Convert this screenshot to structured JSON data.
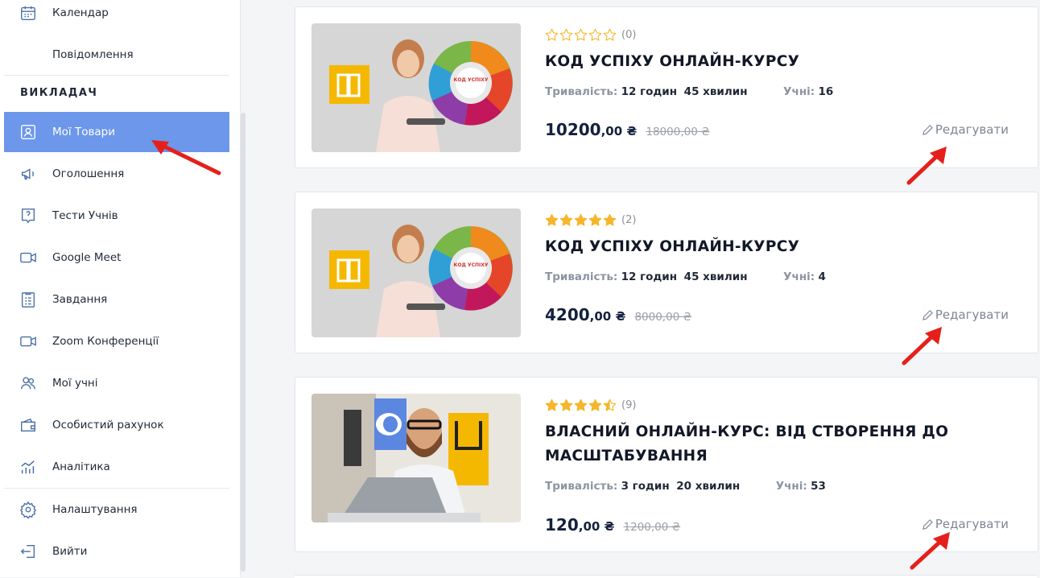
{
  "sidebar": {
    "items_top": [
      {
        "label": "Календар",
        "icon": "calendar-icon"
      },
      {
        "label": "Повідомлення",
        "icon": ""
      }
    ],
    "section_title": "ВИКЛАДАЧ",
    "items": [
      {
        "label": "Мої Товари",
        "icon": "user-card-icon",
        "active": true
      },
      {
        "label": "Оголошення",
        "icon": "megaphone-icon"
      },
      {
        "label": "Тести Учнів",
        "icon": "quiz-icon"
      },
      {
        "label": "Google Meet",
        "icon": "video-camera-icon"
      },
      {
        "label": "Завдання",
        "icon": "clipboard-icon"
      },
      {
        "label": "Zoom Конференції",
        "icon": "video-camera-icon"
      },
      {
        "label": "Мої учні",
        "icon": "users-icon"
      },
      {
        "label": "Особистий рахунок",
        "icon": "wallet-icon"
      },
      {
        "label": "Аналітика",
        "icon": "chart-icon"
      }
    ],
    "items_bottom": [
      {
        "label": "Налаштування",
        "icon": "gear-icon"
      },
      {
        "label": "Вийти",
        "icon": "logout-icon"
      }
    ]
  },
  "courses": [
    {
      "rating": 0,
      "rating_count": "(0)",
      "title": "КОД УСПІХУ ОНЛАЙН-КУРСУ",
      "duration_label": "Тривалість:",
      "duration_hours": "12 годин",
      "duration_minutes": "45 хвилин",
      "students_label": "Учні:",
      "students": "16",
      "price_main": "10200",
      "price_dec": ",00 ₴",
      "price_old": "18000,00 ₴",
      "edit_label": "Редагувати"
    },
    {
      "rating": 5,
      "rating_count": "(2)",
      "title": "КОД УСПІХУ ОНЛАЙН-КУРСУ",
      "duration_label": "Тривалість:",
      "duration_hours": "12 годин",
      "duration_minutes": "45 хвилин",
      "students_label": "Учні:",
      "students": "4",
      "price_main": "4200",
      "price_dec": ",00 ₴",
      "price_old": "8000,00 ₴",
      "edit_label": "Редагувати"
    },
    {
      "rating": 4.5,
      "rating_count": "(9)",
      "title": "ВЛАСНИЙ ОНЛАЙН-КУРС: ВІД СТВОРЕННЯ ДО МАСШТАБУВАННЯ",
      "duration_label": "Тривалість:",
      "duration_hours": "3 годин",
      "duration_minutes": "20 хвилин",
      "students_label": "Учні:",
      "students": "53",
      "price_main": "120",
      "price_dec": ",00 ₴",
      "price_old": "1200,00 ₴",
      "edit_label": "Редагувати"
    }
  ],
  "colors": {
    "active_item": "#6c97ea",
    "star": "#f5b62a",
    "arrow": "#e5201b",
    "price": "#14213d"
  }
}
